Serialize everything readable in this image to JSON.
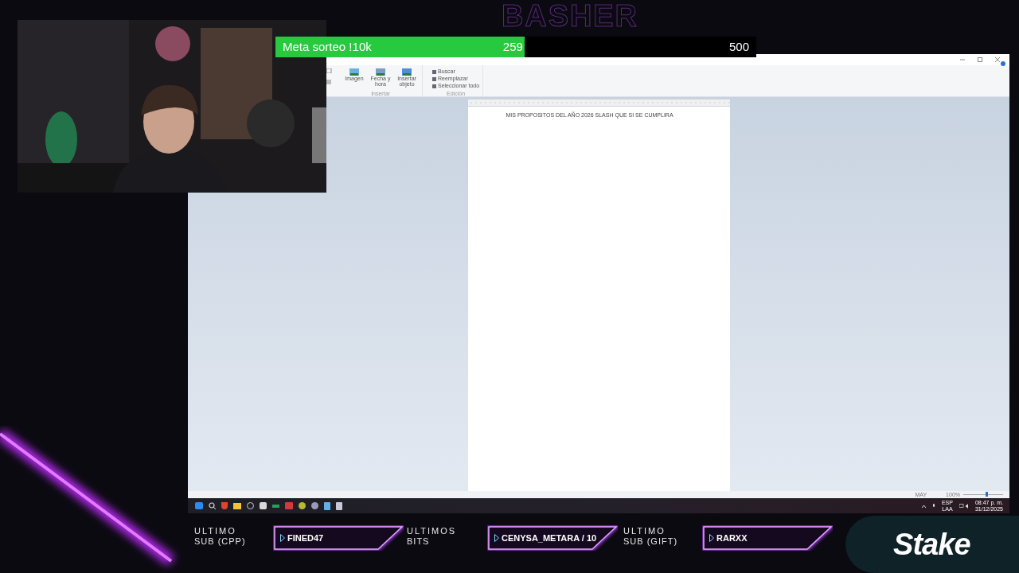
{
  "background_logo": "BASHER",
  "goal": {
    "title": "Meta sorteo !10k",
    "current": "259",
    "target": "500",
    "level": 0.518
  },
  "editor": {
    "ribbon_groups": [
      {
        "label": "Insertar",
        "kind": "large",
        "buttons": [
          "Imagen",
          "Fecha y hora",
          "Insertar objeto"
        ]
      },
      {
        "label": "Edición",
        "kind": "small",
        "buttons": [
          "Buscar",
          "Reemplazar",
          "Seleccionar todo"
        ]
      }
    ],
    "document_text": "MIS PROPOSITOS DEL AÑO 2026 SLASH QUE SI SE CUMPLIRA",
    "status": {
      "caps": "MAY",
      "zoom": "100%",
      "level": 0.55
    }
  },
  "taskbar": {
    "language": "ESP",
    "layout": "LAA",
    "time": "08:47 p. m.",
    "date": "31/12/2025"
  },
  "ticker": [
    {
      "label_top": "ULTIMO",
      "label_bottom": "SUB (CPP)",
      "value": "FINED47"
    },
    {
      "label_top": "ULTIMOS",
      "label_bottom": "BITS",
      "value": "CENYSA_METARA / 10"
    },
    {
      "label_top": "ULTIMO",
      "label_bottom": "SUB (GIFT)",
      "value": "RARXX"
    }
  ],
  "sponsor": "Stake"
}
